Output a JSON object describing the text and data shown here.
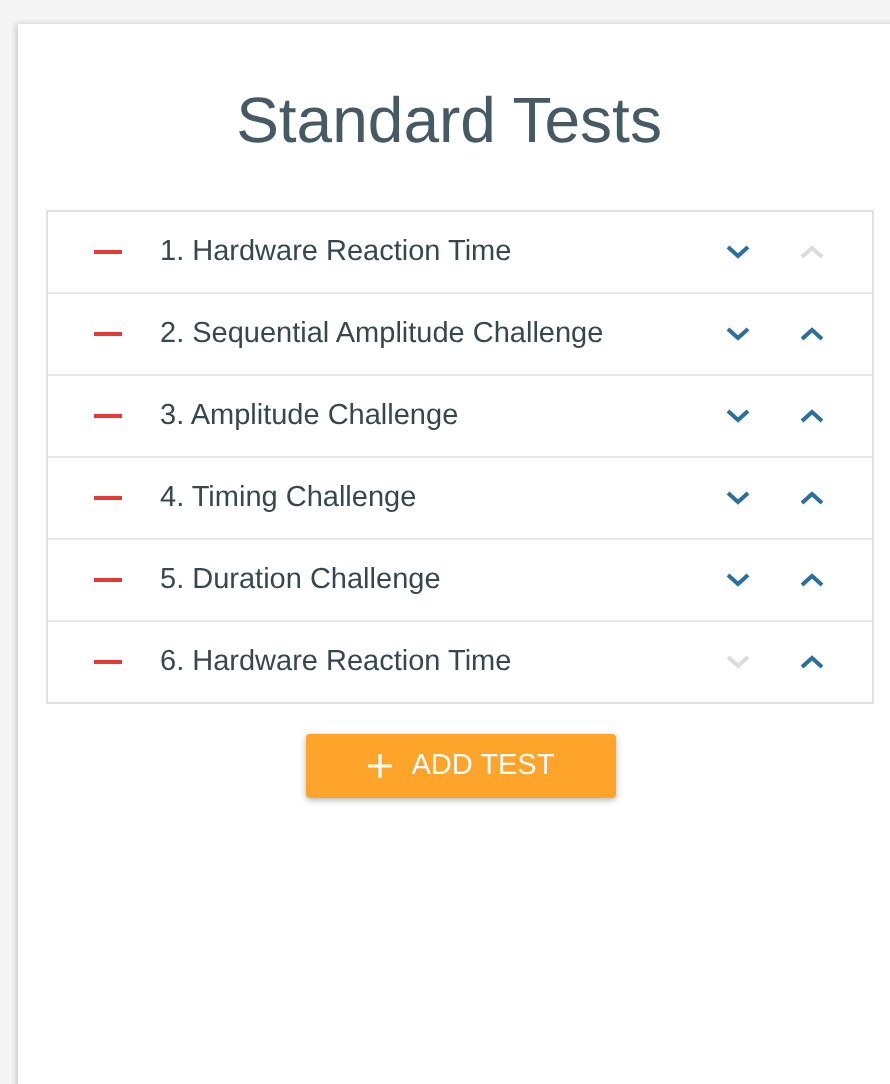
{
  "title": "Standard Tests",
  "tests": [
    {
      "label": "1. Hardware Reaction Time",
      "can_move_down": true,
      "can_move_up": false
    },
    {
      "label": "2. Sequential Amplitude Challenge",
      "can_move_down": true,
      "can_move_up": true
    },
    {
      "label": "3. Amplitude Challenge",
      "can_move_down": true,
      "can_move_up": true
    },
    {
      "label": "4. Timing Challenge",
      "can_move_down": true,
      "can_move_up": true
    },
    {
      "label": "5. Duration Challenge",
      "can_move_down": true,
      "can_move_up": true
    },
    {
      "label": "6. Hardware Reaction Time",
      "can_move_down": false,
      "can_move_up": true
    }
  ],
  "add_button": "ADD TEST"
}
